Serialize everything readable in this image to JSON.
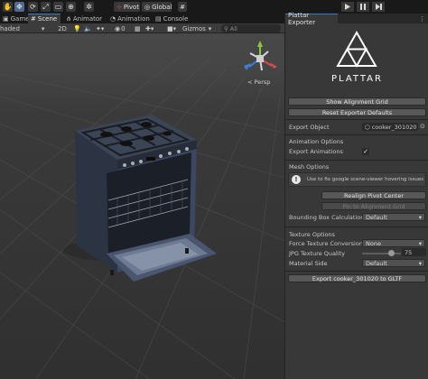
{
  "toolbar": {
    "tools": [
      "hand-tool",
      "move-tool",
      "rotate-tool",
      "scale-tool",
      "rect-tool",
      "transform-tool",
      "custom-tool"
    ],
    "pivot_label": "Pivot",
    "global_label": "Global"
  },
  "left_tabs": [
    {
      "label": "Game"
    },
    {
      "label": "Scene"
    },
    {
      "label": "Animator"
    },
    {
      "label": "Animation"
    },
    {
      "label": "Console"
    }
  ],
  "scene_toolbar": {
    "shading_mode": "haded",
    "mode_2d": "2D",
    "hidden_count": "0",
    "gizmos_label": "Gizmos",
    "search_placeholder": "All"
  },
  "scene": {
    "persp_label": "< Persp",
    "axis_colors": {
      "x": "#d64a4a",
      "y": "#8ec63f",
      "z": "#3d7fd8"
    }
  },
  "panel": {
    "title": "Plattar Exporter",
    "logo_text": "PLATTAR",
    "show_grid_button": "Show Alignment Grid",
    "reset_defaults_button": "Reset Exporter Defaults",
    "export_object_label": "Export Object",
    "export_object_value": "cooker_301020",
    "animation_section": "Animation Options",
    "export_animations_label": "Export Animations",
    "export_animations_checked": true,
    "mesh_section": "Mesh Options",
    "mesh_help_text": "Use to fix google scene-viewer hovering issues",
    "realign_button": "Realign Pivot Center",
    "pin_button": "Pin to Alignment Grid",
    "bbox_label": "Bounding Box Calculation",
    "bbox_value": "Default",
    "texture_section": "Texture Options",
    "force_conversion_label": "Force Texture Conversion",
    "force_conversion_value": "None",
    "jpg_quality_label": "JPG Texture Quality",
    "jpg_quality_value": "75",
    "jpg_quality_fraction": 0.75,
    "material_side_label": "Material Side",
    "material_side_value": "Default",
    "export_button": "Export cooker_301020 to GLTF"
  }
}
